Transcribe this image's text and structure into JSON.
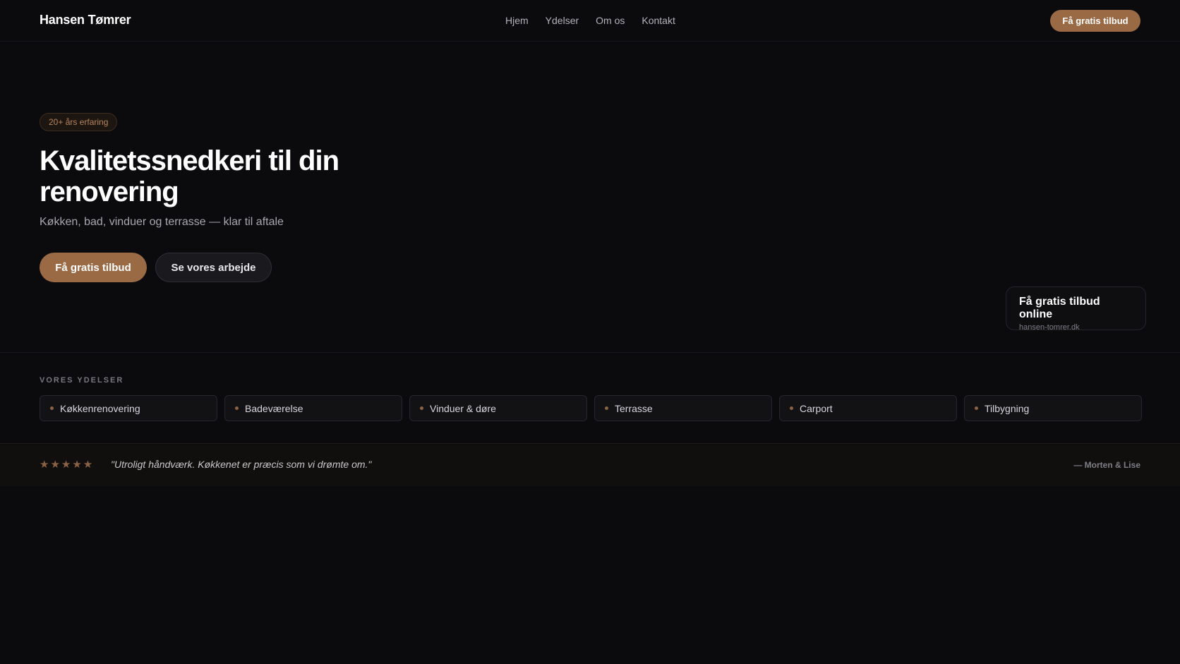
{
  "header": {
    "brand": "Hansen Tømrer",
    "nav": [
      "Hjem",
      "Ydelser",
      "Om os",
      "Kontakt"
    ],
    "cta_label": "Få gratis tilbud"
  },
  "hero": {
    "badge": "20+ års erfaring",
    "title": "Kvalitetssnedkeri til din renovering",
    "subtitle": "Køkken, bad, vinduer og terrasse — klar til aftale",
    "primary_button": "Få gratis tilbud",
    "secondary_button": "Se vores arbejde"
  },
  "online_card": {
    "title": "Få gratis tilbud online",
    "url": "hansen-tomrer.dk"
  },
  "services": {
    "heading": "VORES YDELSER",
    "items": [
      "Køkkenrenovering",
      "Badeværelse",
      "Vinduer & døre",
      "Terrasse",
      "Carport",
      "Tilbygning"
    ]
  },
  "testimonial": {
    "stars": "★★★★★",
    "rating": 5,
    "quote": "\"Utroligt håndværk. Køkkenet er præcis som vi drømte om.\"",
    "author": "— Morten & Lise"
  },
  "colors": {
    "background": "#0b0b0d",
    "accent": "#9a6a45",
    "accent_text": "#b8865f"
  }
}
